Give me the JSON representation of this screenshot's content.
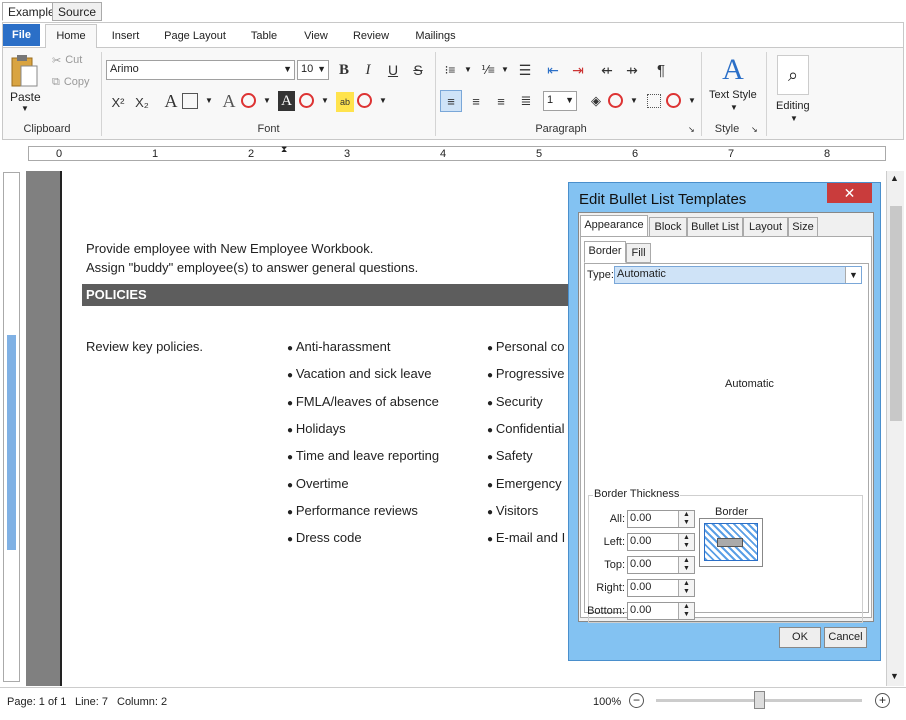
{
  "top_tabs": [
    "Example",
    "Source"
  ],
  "ribbon_tabs": [
    "File",
    "Home",
    "Insert",
    "Page Layout",
    "Table",
    "View",
    "Review",
    "Mailings"
  ],
  "clipboard": {
    "paste": "Paste",
    "cut": "Cut",
    "copy": "Copy",
    "label": "Clipboard"
  },
  "font": {
    "name": "Arimo",
    "size": "10",
    "label": "Font"
  },
  "paragraph": {
    "spacing": "1",
    "label": "Paragraph"
  },
  "style": {
    "text_style": "Text Style",
    "label": "Style"
  },
  "editing": {
    "label": "Editing"
  },
  "ruler_numbers": [
    "0",
    "1",
    "2",
    "3",
    "4",
    "5",
    "6",
    "7",
    "8"
  ],
  "document": {
    "line1": "Provide employee with New Employee Workbook.",
    "line2": "Assign \"buddy\" employee(s) to answer general questions.",
    "heading": "POLICIES",
    "review": "Review key policies.",
    "bullets_col1": [
      "Anti-harassment",
      "Vacation and sick leave",
      "FMLA/leaves of absence",
      "Holidays",
      "Time and leave reporting",
      "Overtime",
      "Performance reviews",
      "Dress code"
    ],
    "bullets_col2": [
      "Personal co",
      "Progressive",
      "Security",
      "Confidential",
      "Safety",
      "Emergency",
      "Visitors",
      "E-mail and I"
    ]
  },
  "status": {
    "page": "Page: 1 of 1",
    "line": "Line: 7",
    "column": "Column: 2",
    "zoom": "100%",
    "zoom_level": 1.0
  },
  "dialog": {
    "title": "Edit Bullet List Templates",
    "tabs": [
      "Appearance",
      "Block",
      "Bullet List",
      "Layout",
      "Size"
    ],
    "subtabs": [
      "Border",
      "Fill"
    ],
    "type_label": "Type:",
    "type_value": "Automatic",
    "preview_text": "Automatic",
    "thickness_label": "Border Thickness",
    "thickness": [
      {
        "label": "All:",
        "value": "0.00"
      },
      {
        "label": "Left:",
        "value": "0.00"
      },
      {
        "label": "Top:",
        "value": "0.00"
      },
      {
        "label": "Right:",
        "value": "0.00"
      },
      {
        "label": "Bottom:",
        "value": "0.00"
      }
    ],
    "border_label": "Border",
    "ok": "OK",
    "cancel": "Cancel"
  }
}
